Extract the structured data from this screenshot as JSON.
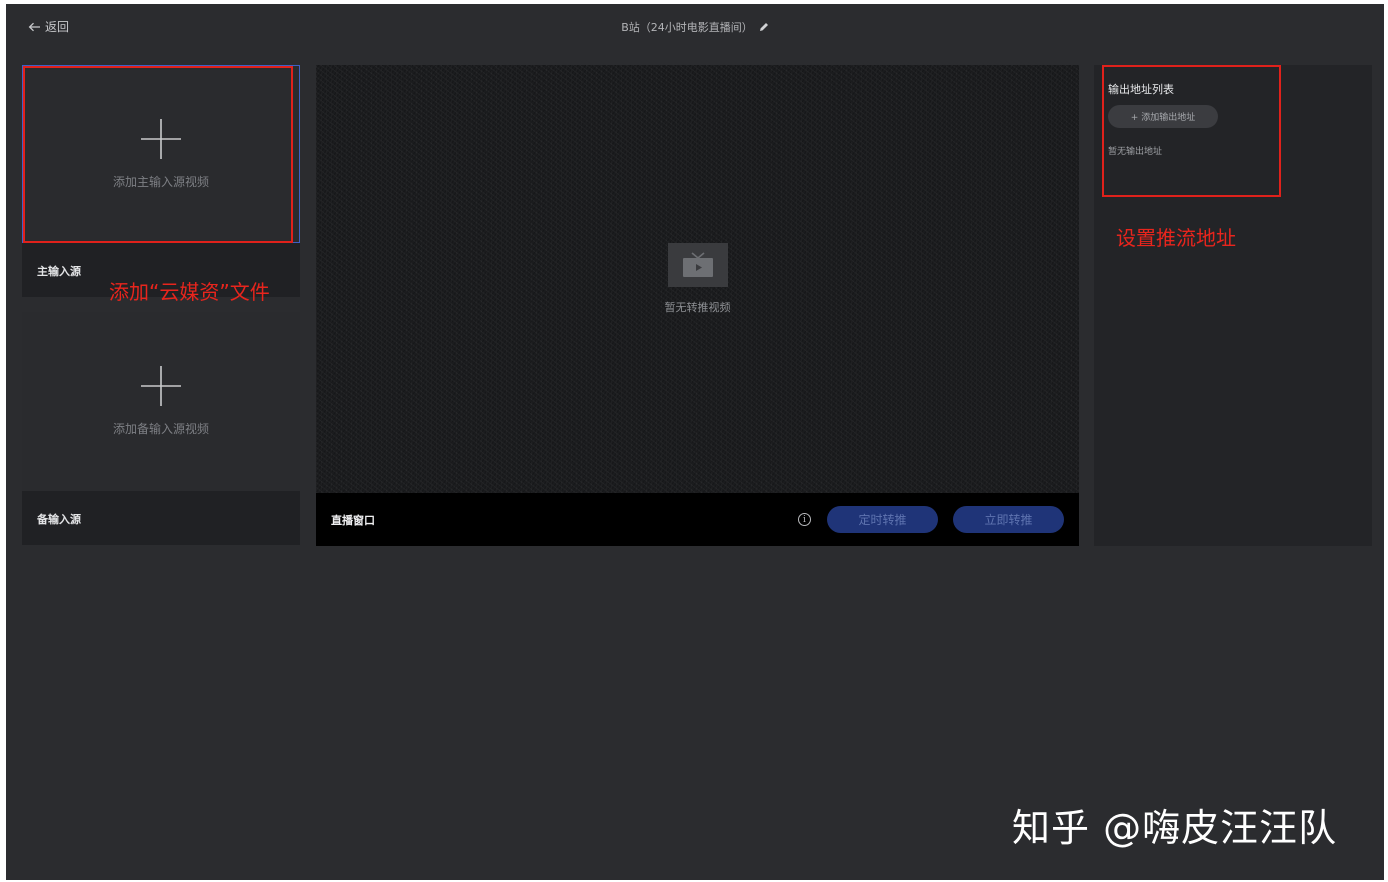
{
  "topbar": {
    "back_label": "返回",
    "title": "B站（24小时电影直播间）"
  },
  "inputs": {
    "main": {
      "drop_label": "添加主输入源视频",
      "footer": "主输入源"
    },
    "backup": {
      "drop_label": "添加备输入源视频",
      "footer": "备输入源"
    }
  },
  "player": {
    "empty_text": "暂无转推视频",
    "window_label": "直播窗口",
    "scheduled_button": "定时转推",
    "now_button": "立即转推"
  },
  "output": {
    "heading": "输出地址列表",
    "add_button": "+ 添加输出地址",
    "empty_text": "暂无输出地址"
  },
  "annotations": {
    "left": "添加“云媒资”文件",
    "right": "设置推流地址"
  },
  "watermark": "知乎 @嗨皮汪汪队",
  "colors": {
    "page_bg": "#2b2c2f",
    "annotation_red": "#e0211b",
    "highlight_blue": "#3e5fc6",
    "primary_button": "#1f3478"
  }
}
